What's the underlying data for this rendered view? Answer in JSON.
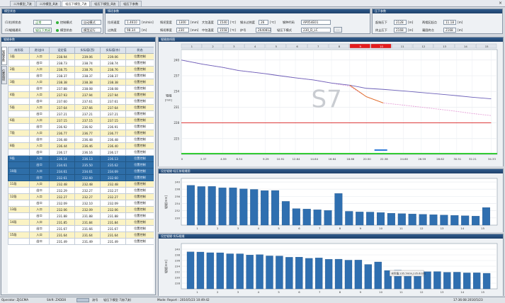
{
  "tabs": [
    {
      "label": "二冷模型_7流"
    },
    {
      "label": "二冷模型_8流"
    },
    {
      "label": "轻压下模型_7流"
    },
    {
      "label": "轻压下模型_8流"
    },
    {
      "label": "轻压下参数"
    }
  ],
  "state_panel": {
    "title": "模型状态",
    "model_state_label": "(1)拉矫状态",
    "model_state_value": "正常",
    "link_label": "(1)辊缝通讯",
    "link_value": "轻压下关闭",
    "mode_label": "控制模式",
    "mode_value": "自动模式",
    "action_label": "模型状态",
    "action_value": "模型运行"
  },
  "process_panel": {
    "title": "铸坯参数",
    "cast_speed_label": "拉坯速度",
    "cast_speed_value": "1.4610",
    "cast_speed_unit": "[m/min]",
    "width_label": "铸坯宽度",
    "width_value": "1300",
    "width_unit": "[mm]",
    "thick_label": "铸坯厚度",
    "thick_value": "230",
    "thick_unit": "[mm]",
    "superheat_label": "钢水过热度",
    "superheat_value": "26",
    "superheat_unit": "[℃]",
    "steel_label": "钢种代码",
    "steel_value": "AP054E01",
    "target_label": "过热度",
    "target_value": "98.34",
    "target_unit": "[m]",
    "temp_label": "中包温度",
    "temp_value": "1558",
    "temp_unit": "[℃]",
    "liquidus_label": "大包温度",
    "liquidus_value": "1540",
    "liquidus_unit": "[℃]",
    "heat_label": "炉号",
    "heat_value": "2640812",
    "mode_label": "轻压下模式",
    "mode_value": "230_D_LC",
    "more_btn": "..."
  },
  "reduce_panel": {
    "title": "压下参数",
    "start_label": "起始压下",
    "start_value": "2128",
    "start_unit": "[m]",
    "end_label": "终止压下",
    "end_value": "2168",
    "end_unit": "[m]",
    "total_label": "两相区起点",
    "total_value": "11.18",
    "total_unit": "[m]",
    "final_label": "凝固终点",
    "final_value": "2168",
    "final_unit": "[m]"
  },
  "roll_table": {
    "title": "辊缝参数",
    "side_tabs": [
      "辊缝参数",
      "位置曲线"
    ],
    "columns": [
      "扇形段",
      "进/出口",
      "设定值",
      "实际值(西)",
      "实际值(东)",
      "状态"
    ],
    "rows": [
      {
        "seg": "1段",
        "pos": "入口",
        "set": "238.94",
        "w": "239.06",
        "e": "239.06",
        "st": "位置控制",
        "style": "y"
      },
      {
        "seg": "",
        "pos": "出口",
        "set": "238.73",
        "w": "238.74",
        "e": "238.74",
        "st": "位置控制",
        "style": "w"
      },
      {
        "seg": "2段",
        "pos": "入口",
        "set": "238.75",
        "w": "238.76",
        "e": "238.76",
        "st": "位置控制",
        "style": "y"
      },
      {
        "seg": "",
        "pos": "出口",
        "set": "238.37",
        "w": "238.37",
        "e": "238.37",
        "st": "位置控制",
        "style": "w"
      },
      {
        "seg": "3段",
        "pos": "入口",
        "set": "238.38",
        "w": "238.38",
        "e": "238.38",
        "st": "位置控制",
        "style": "y"
      },
      {
        "seg": "",
        "pos": "出口",
        "set": "237.88",
        "w": "238.08",
        "e": "238.08",
        "st": "位置控制",
        "style": "w"
      },
      {
        "seg": "4段",
        "pos": "入口",
        "set": "237.93",
        "w": "237.94",
        "e": "237.94",
        "st": "位置控制",
        "style": "y"
      },
      {
        "seg": "",
        "pos": "出口",
        "set": "237.60",
        "w": "237.61",
        "e": "237.61",
        "st": "位置控制",
        "style": "w"
      },
      {
        "seg": "5段",
        "pos": "入口",
        "set": "237.64",
        "w": "237.66",
        "e": "237.64",
        "st": "位置控制",
        "style": "y"
      },
      {
        "seg": "",
        "pos": "出口",
        "set": "237.21",
        "w": "237.21",
        "e": "237.21",
        "st": "位置控制",
        "style": "w"
      },
      {
        "seg": "6段",
        "pos": "入口",
        "set": "237.15",
        "w": "237.15",
        "e": "237.15",
        "st": "位置控制",
        "style": "y"
      },
      {
        "seg": "",
        "pos": "出口",
        "set": "236.92",
        "w": "236.92",
        "e": "236.91",
        "st": "位置控制",
        "style": "w"
      },
      {
        "seg": "7段",
        "pos": "入口",
        "set": "236.77",
        "w": "236.77",
        "e": "236.77",
        "st": "位置控制",
        "style": "y"
      },
      {
        "seg": "",
        "pos": "出口",
        "set": "236.48",
        "w": "236.48",
        "e": "236.48",
        "st": "位置控制",
        "style": "w"
      },
      {
        "seg": "8段",
        "pos": "入口",
        "set": "236.44",
        "w": "236.46",
        "e": "236.40",
        "st": "位置控制",
        "style": "y"
      },
      {
        "seg": "",
        "pos": "出口",
        "set": "236.17",
        "w": "236.16",
        "e": "236.17",
        "st": "位置控制",
        "style": "w"
      },
      {
        "seg": "9段",
        "pos": "入口",
        "set": "236.14",
        "w": "236.13",
        "e": "236.13",
        "st": "位置控制",
        "style": "s"
      },
      {
        "seg": "",
        "pos": "出口",
        "set": "234.61",
        "w": "235.50",
        "e": "235.62",
        "st": "位置控制",
        "style": "s"
      },
      {
        "seg": "10段",
        "pos": "入口",
        "set": "234.61",
        "w": "234.61",
        "e": "234.69",
        "st": "位置控制",
        "style": "s"
      },
      {
        "seg": "",
        "pos": "出口",
        "set": "232.61",
        "w": "232.60",
        "e": "232.60",
        "st": "位置控制",
        "style": "s"
      },
      {
        "seg": "11段",
        "pos": "入口",
        "set": "232.48",
        "w": "232.48",
        "e": "232.48",
        "st": "位置控制",
        "style": "y"
      },
      {
        "seg": "",
        "pos": "出口",
        "set": "232.29",
        "w": "232.27",
        "e": "232.27",
        "st": "位置控制",
        "style": "w"
      },
      {
        "seg": "12段",
        "pos": "入口",
        "set": "232.27",
        "w": "232.27",
        "e": "232.27",
        "st": "位置控制",
        "style": "y"
      },
      {
        "seg": "",
        "pos": "出口",
        "set": "232.09",
        "w": "232.10",
        "e": "232.09",
        "st": "位置控制",
        "style": "w"
      },
      {
        "seg": "13段",
        "pos": "入口",
        "set": "232.06",
        "w": "232.09",
        "e": "232.06",
        "st": "位置控制",
        "style": "y"
      },
      {
        "seg": "",
        "pos": "出口",
        "set": "231.88",
        "w": "231.88",
        "e": "231.88",
        "st": "位置控制",
        "style": "w"
      },
      {
        "seg": "14段",
        "pos": "入口",
        "set": "231.85",
        "w": "231.84",
        "e": "231.84",
        "st": "位置控制",
        "style": "y"
      },
      {
        "seg": "",
        "pos": "出口",
        "set": "231.67",
        "w": "231.66",
        "e": "231.67",
        "st": "位置控制",
        "style": "w"
      },
      {
        "seg": "15段",
        "pos": "入口",
        "set": "231.64",
        "w": "231.64",
        "e": "231.64",
        "st": "位置控制",
        "style": "y"
      },
      {
        "seg": "",
        "pos": "出口",
        "set": "231.49",
        "w": "231.49",
        "e": "231.49",
        "st": "位置控制",
        "style": "w"
      }
    ]
  },
  "curve_panel": {
    "title": "辊缝曲线图",
    "watermark": "S7",
    "ylabel": "辊缝\n[mm]"
  },
  "bar1_panel": {
    "title": "设定辊缝-轻压前辊缝图",
    "ylabel": "辊缝[mm]"
  },
  "bar2_panel": {
    "title": "设定辊缝-实际辊缝",
    "ylabel": "辊缝[mm]",
    "tooltip": "实际值:235.50(9),235.62(9)"
  },
  "status_bar": {
    "operator": "Operator: ZJGCMA",
    "shift": "Shift: ZXDD0",
    "flow": "流号",
    "info": "轻压下模型 7流(7流)",
    "mode": "Mode: Report : 2016/5/23 10:49:42",
    "time": "17:36:08 2016/5/23"
  },
  "colors": {
    "accent": "#1d416b",
    "bar": "#2f6fb0",
    "selected": "#2e6ea8"
  },
  "chart_data": [
    {
      "type": "line",
      "title": "",
      "x": [
        0,
        2.37,
        4.59,
        6.34,
        9.29,
        10.91,
        12.64,
        14.64,
        16.64,
        18.66,
        20.5,
        22.38,
        24.6,
        26.59,
        28.62,
        30.51,
        32.21,
        34.33
      ],
      "xlim": [
        0,
        35
      ],
      "series": [
        {
          "name": "",
          "color": "#e6a0d8",
          "values": [
            240,
            239.2,
            238.6,
            238.0,
            237.4,
            237.0,
            236.6,
            236.2,
            235.6,
            235.0,
            233.0,
            231.8,
            231.4,
            231.0,
            230.6,
            230.2,
            229.8,
            229.4
          ]
        },
        {
          "name": "",
          "color": "#6b5fb8",
          "values": [
            240,
            239.2,
            238.6,
            238.0,
            237.4,
            237.0,
            236.6,
            236.2,
            235.6,
            235.2,
            234.6,
            234.4,
            234.1,
            233.8,
            233.5,
            233.2,
            232.9,
            232.6
          ]
        },
        {
          "name": "",
          "color": "#e06a20",
          "values": [
            null,
            null,
            null,
            null,
            null,
            null,
            null,
            null,
            null,
            235.2,
            233.0,
            231.8,
            null,
            null,
            null,
            null,
            null,
            null
          ]
        },
        {
          "name": "",
          "color": "#d82020",
          "values": [
            228,
            228,
            228,
            228,
            228,
            228,
            228,
            228,
            228,
            228,
            228,
            228,
            228,
            228,
            228,
            228,
            228,
            228
          ]
        }
      ],
      "ylim": [
        222,
        242
      ],
      "y_ticks": [
        225,
        228,
        231,
        234,
        237,
        240
      ],
      "x_tick_labels": [
        "0",
        "2.37",
        "4.59",
        "6.34",
        "9.29",
        "10.91",
        "12.64",
        "14.64",
        "16.64",
        "18.66",
        "20.50",
        "22.38",
        "24.60",
        "26.59",
        "28.62",
        "30.51",
        "32.21",
        "34.33"
      ],
      "segments": [
        "1",
        "2",
        "3",
        "4",
        "5",
        "6",
        "7",
        "8",
        "9",
        "10",
        "11",
        "12",
        "13",
        "14",
        "15"
      ],
      "highlight_segments": [
        9,
        10
      ]
    },
    {
      "type": "bar",
      "categories": [
        "1",
        "2",
        "3",
        "4",
        "5",
        "6",
        "7",
        "8",
        "9",
        "10",
        "11",
        "12",
        "13",
        "14",
        "15"
      ],
      "series": [
        {
          "name": "",
          "values": [
            239.06,
            238.74,
            238.76,
            238.37,
            238.38,
            238.08,
            237.94,
            237.61,
            237.64,
            234.61,
            232.6,
            232.48,
            232.27,
            232.09,
            236.8,
            231.84,
            231.67,
            231.64,
            231.49,
            231.3,
            231.2,
            231.1,
            231.0,
            230.9,
            230.8,
            230.7,
            230.6,
            230.5,
            232.9
          ]
        }
      ],
      "ylim": [
        228,
        241
      ],
      "y_ticks": [
        230,
        232,
        234,
        236,
        238,
        240
      ]
    },
    {
      "type": "bar",
      "categories": [
        "1",
        "2",
        "3",
        "4",
        "5",
        "6",
        "7",
        "8",
        "9",
        "10",
        "11",
        "12",
        "13",
        "14",
        "15"
      ],
      "series": [
        {
          "name": "",
          "values": [
            239.06,
            239.0,
            238.76,
            238.74,
            238.38,
            238.37,
            237.94,
            238.08,
            237.64,
            237.61,
            237.15,
            237.21,
            236.77,
            236.92,
            236.44,
            236.48,
            236.13,
            236.16,
            234.61,
            235.5,
            232.48,
            232.6,
            232.27,
            232.27,
            232.06,
            232.1,
            231.84,
            231.88,
            231.64,
            231.66,
            231.5
          ]
        }
      ],
      "ylim": [
        226,
        242
      ],
      "y_ticks": [
        228,
        230,
        232,
        234,
        236,
        238,
        240
      ]
    }
  ]
}
